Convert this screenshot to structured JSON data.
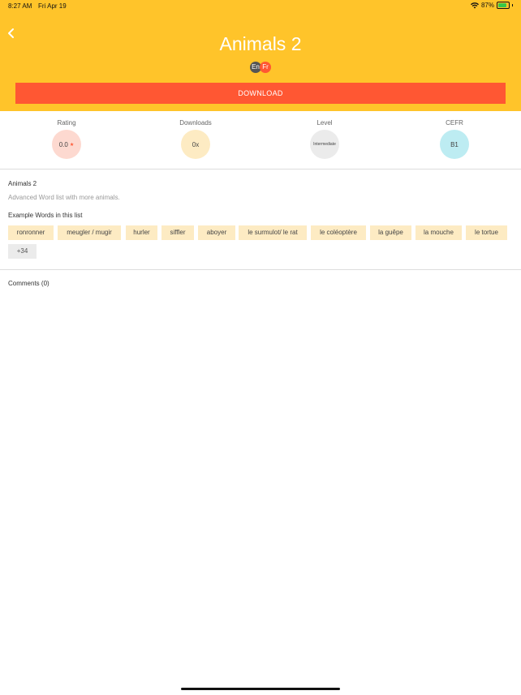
{
  "status_bar": {
    "time": "8:27 AM",
    "date": "Fri Apr 19",
    "battery": "87%",
    "battery_level": 0.87
  },
  "header": {
    "title": "Animals 2",
    "lang_from": "En",
    "lang_to": "Fr",
    "download_label": "DOWNLOAD"
  },
  "stats": {
    "rating_label": "Rating",
    "rating_value": "0.0",
    "rating_star": "★",
    "downloads_label": "Downloads",
    "downloads_value": "0x",
    "level_label": "Level",
    "level_value": "Intermediate",
    "cefr_label": "CEFR",
    "cefr_value": "B1"
  },
  "colors": {
    "header_bg": "#FFC42A",
    "accent": "#FF5733",
    "rating_circle": "#FDD9D0",
    "downloads_circle": "#FDEBC3",
    "level_circle": "#EBEBEB",
    "cefr_circle": "#BDECF2"
  },
  "list": {
    "name": "Animals 2",
    "description": "Advanced Word list with more animals.",
    "examples_heading": "Example Words in this list",
    "words": [
      "ronronner",
      "meugler / mugir",
      "hurler",
      "siffler",
      "aboyer",
      "le surmulot/ le rat",
      "le coléoptère",
      "la guêpe",
      "la mouche",
      "le tortue"
    ],
    "more": "+34"
  },
  "comments": {
    "label": "Comments (0)"
  }
}
